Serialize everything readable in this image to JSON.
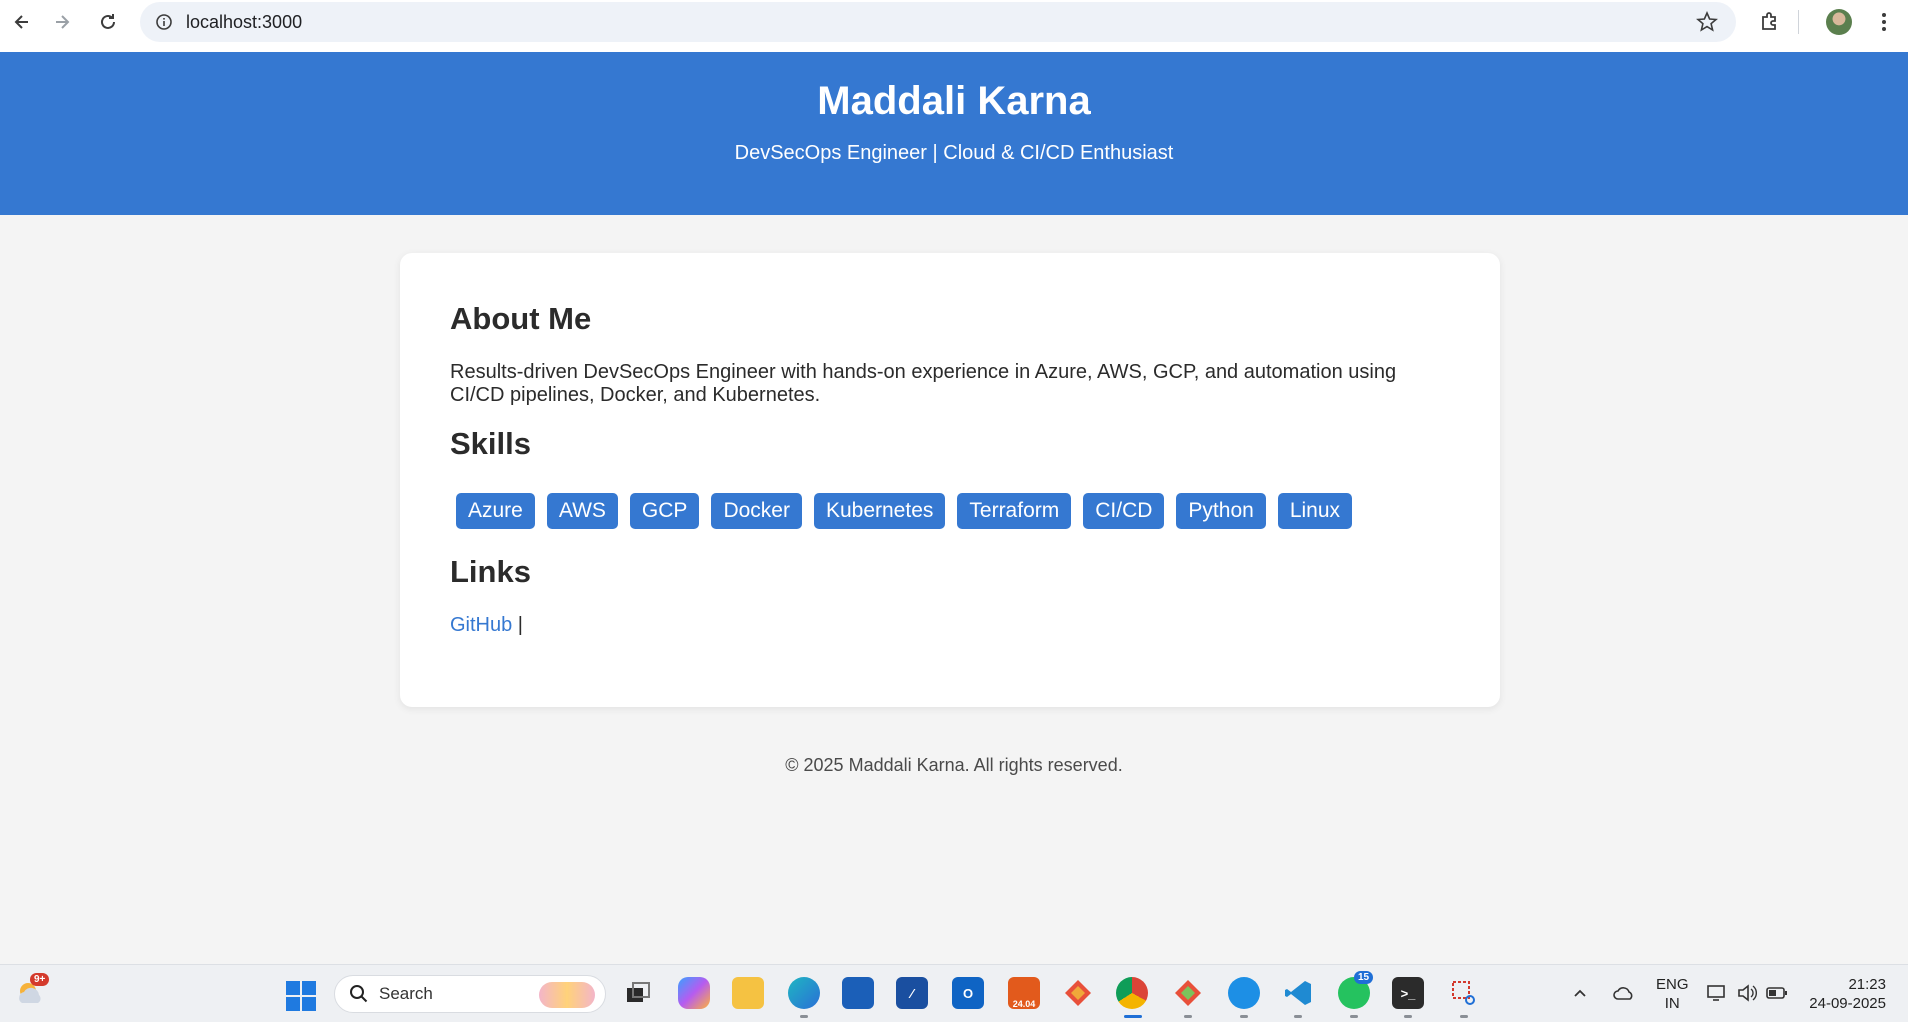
{
  "browser": {
    "url": "localhost:3000"
  },
  "header": {
    "name": "Maddali Karna",
    "tagline": "DevSecOps Engineer | Cloud & CI/CD Enthusiast"
  },
  "about": {
    "heading": "About Me",
    "text": "Results-driven DevSecOps Engineer with hands-on experience in Azure, AWS, GCP, and automation using CI/CD pipelines, Docker, and Kubernetes."
  },
  "skills": {
    "heading": "Skills",
    "items": [
      "Azure",
      "AWS",
      "GCP",
      "Docker",
      "Kubernetes",
      "Terraform",
      "CI/CD",
      "Python",
      "Linux"
    ]
  },
  "links": {
    "heading": "Links",
    "github": "GitHub",
    "separator": " |"
  },
  "footer": {
    "text": "© 2025 Maddali Karna. All rights reserved."
  },
  "taskbar": {
    "weather_badge": "9+",
    "search_label": "Search",
    "whatsapp_badge": "15",
    "ubuntu_label": "24.04",
    "lang_line1": "ENG",
    "lang_line2": "IN",
    "time": "21:23",
    "date": "24-09-2025"
  },
  "colors": {
    "accent": "#3578d1",
    "page_bg": "#f4f4f4"
  }
}
